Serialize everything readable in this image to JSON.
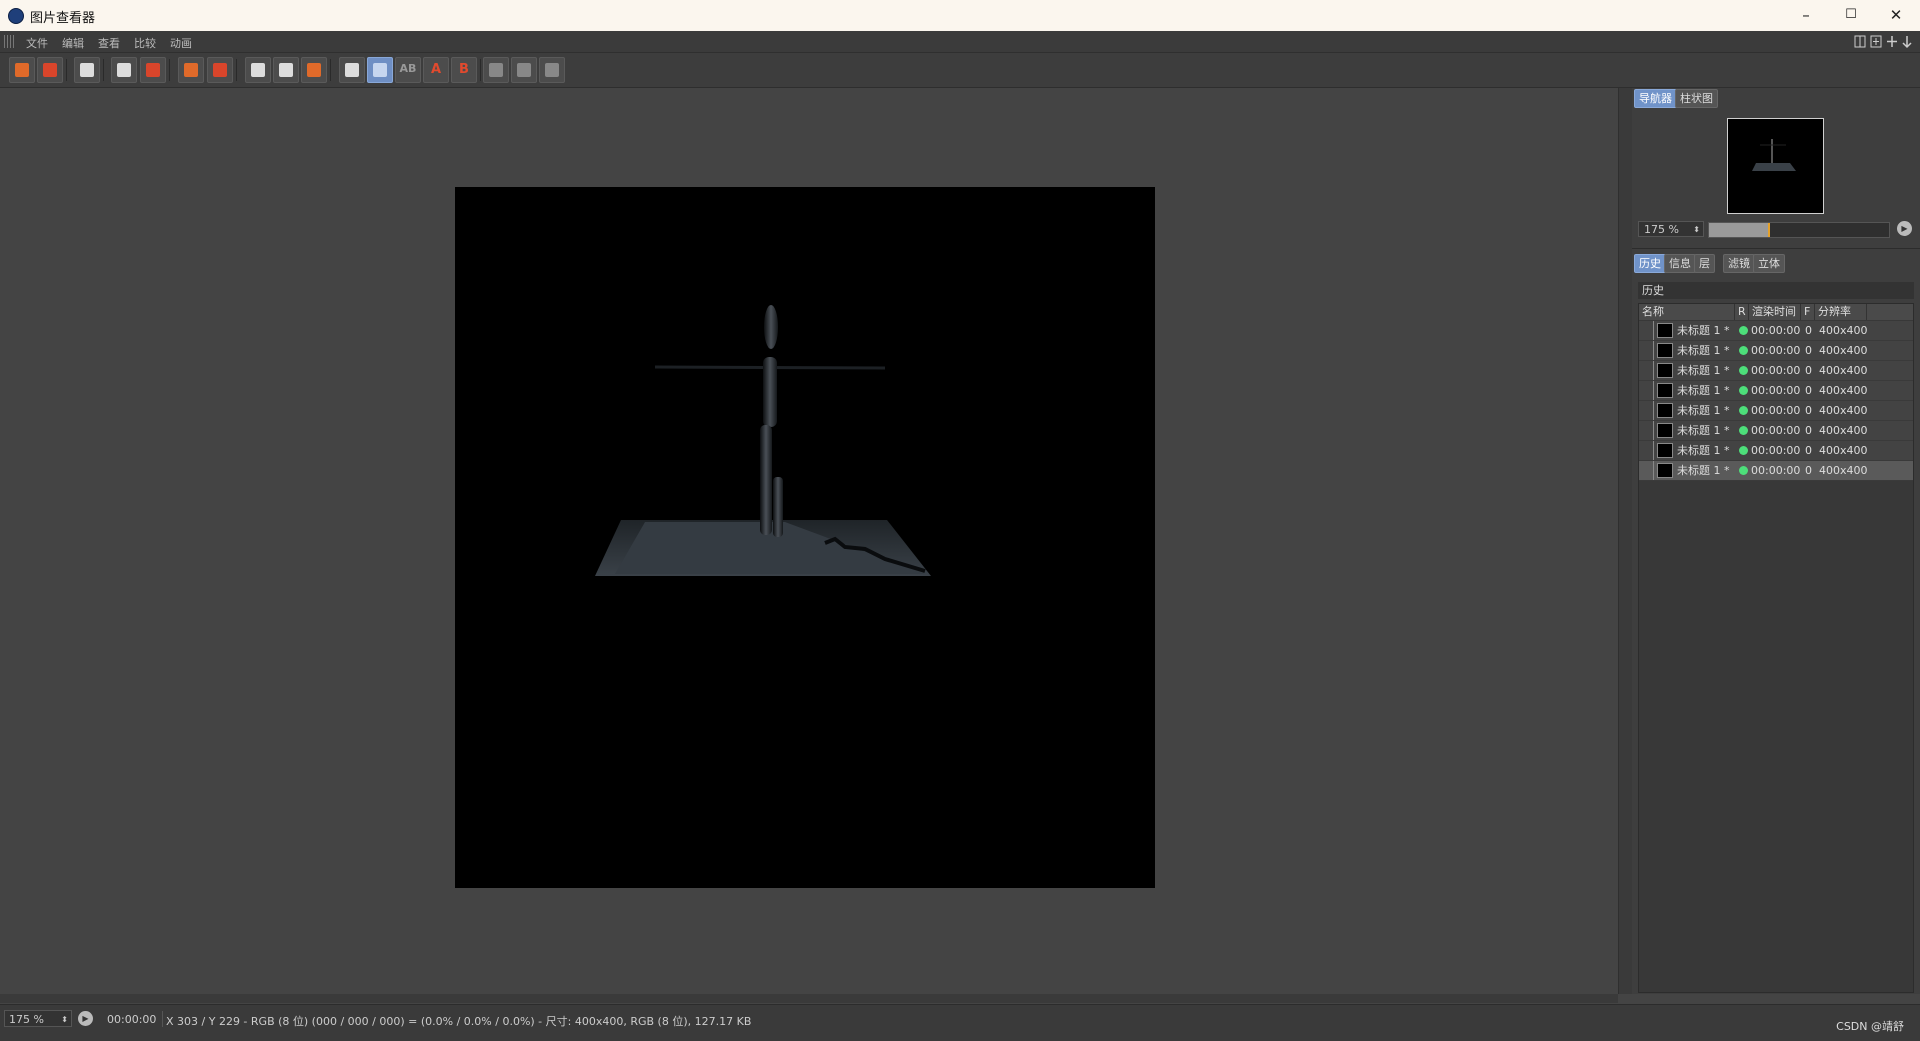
{
  "window": {
    "title": "图片查看器",
    "minimize": "–",
    "maximize": "☐",
    "close": "✕"
  },
  "menu": [
    "文件",
    "编辑",
    "查看",
    "比较",
    "动画"
  ],
  "nav": {
    "tabs": [
      "导航器",
      "柱状图"
    ],
    "active_tab": "导航器",
    "zoom": "175 %",
    "zoom_level": 0.33
  },
  "panel_tabs": [
    "历史",
    "信息",
    "层",
    "滤镜",
    "立体"
  ],
  "active_panel_tab": "历史",
  "history": {
    "section_label": "历史",
    "columns": [
      "名称",
      "R",
      "渲染时间",
      "F",
      "分辨率"
    ],
    "rows": [
      {
        "name": "未标题 1 *",
        "time": "00:00:00",
        "frames": "0",
        "res": "400x400"
      },
      {
        "name": "未标题 1 *",
        "time": "00:00:00",
        "frames": "0",
        "res": "400x400"
      },
      {
        "name": "未标题 1 *",
        "time": "00:00:00",
        "frames": "0",
        "res": "400x400"
      },
      {
        "name": "未标题 1 *",
        "time": "00:00:00",
        "frames": "0",
        "res": "400x400"
      },
      {
        "name": "未标题 1 *",
        "time": "00:00:00",
        "frames": "0",
        "res": "400x400"
      },
      {
        "name": "未标题 1 *",
        "time": "00:00:00",
        "frames": "0",
        "res": "400x400"
      },
      {
        "name": "未标题 1 *",
        "time": "00:00:00",
        "frames": "0",
        "res": "400x400"
      },
      {
        "name": "未标题 1 *",
        "time": "00:00:00",
        "frames": "0",
        "res": "400x400"
      }
    ],
    "status_color": "#4ddf7a"
  },
  "status": {
    "zoom": "175 %",
    "time": "00:00:00",
    "info": "X 303 / Y 229 - RGB (8 位) (000 / 000 / 000) = (0.0% / 0.0% / 0.0%) - 尺寸: 400x400, RGB (8 位), 127.17 KB",
    "watermark": "CSDN @靖舒"
  },
  "toolbar_icons": [
    "open-icon",
    "save-icon",
    "grid-icon",
    "crosshair-icon",
    "person-icon",
    "copy-to-icon",
    "layers-icon",
    "window-a-icon",
    "window-b-icon",
    "window-c-icon",
    "compare-ab-icon",
    "compare-active-icon",
    "ab-icon",
    "a-icon",
    "b-icon",
    "view1-icon",
    "view2-icon",
    "view3-icon"
  ],
  "toolbar_letters": {
    "ab": "AB",
    "a": "A",
    "b": "B"
  },
  "accent": "#7093c9"
}
